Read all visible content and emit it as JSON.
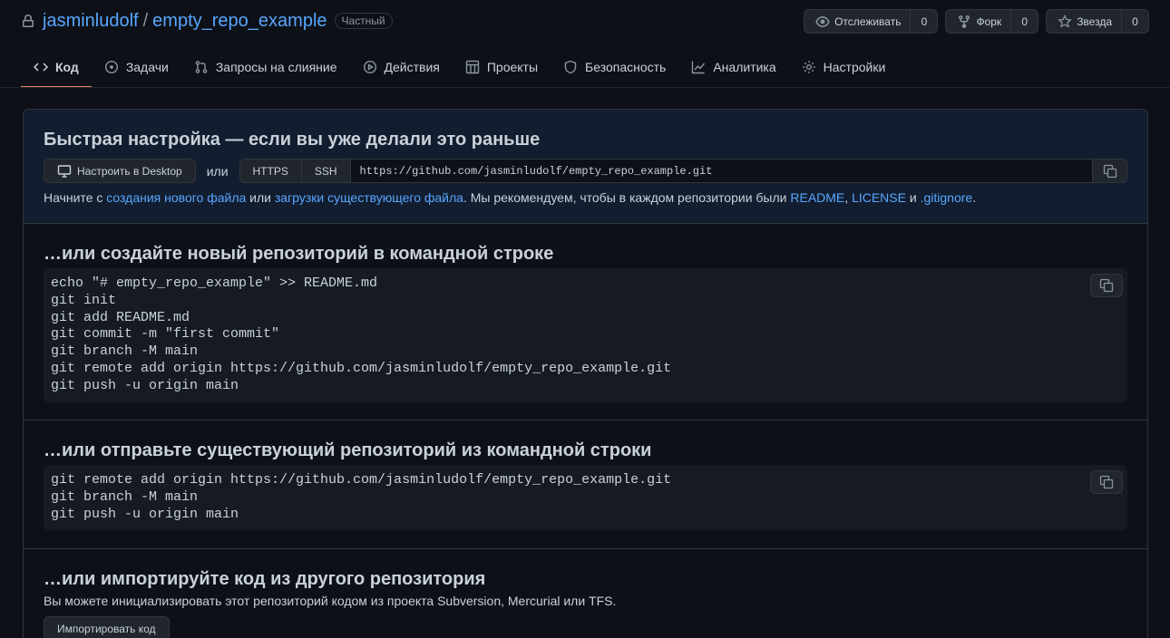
{
  "repo": {
    "owner": "jasminludolf",
    "separator": "/",
    "name": "empty_repo_example",
    "visibility": "Частный"
  },
  "actions": [
    {
      "label": "Отслеживать",
      "count": "0",
      "icon": "eye-icon"
    },
    {
      "label": "Форк",
      "count": "0",
      "icon": "fork-icon"
    },
    {
      "label": "Звезда",
      "count": "0",
      "icon": "star-icon"
    }
  ],
  "tabs": [
    {
      "label": "Код",
      "icon": "code-icon",
      "active": true
    },
    {
      "label": "Задачи",
      "icon": "issue-icon"
    },
    {
      "label": "Запросы на слияние",
      "icon": "pull-request-icon"
    },
    {
      "label": "Действия",
      "icon": "play-icon"
    },
    {
      "label": "Проекты",
      "icon": "table-icon"
    },
    {
      "label": "Безопасность",
      "icon": "shield-icon"
    },
    {
      "label": "Аналитика",
      "icon": "graph-icon"
    },
    {
      "label": "Настройки",
      "icon": "gear-icon"
    }
  ],
  "quick_setup": {
    "title": "Быстрая настройка — если вы уже делали это раньше",
    "desktop_button": "Настроить в Desktop",
    "or": "или",
    "protocols": [
      "HTTPS",
      "SSH"
    ],
    "clone_url": "https://github.com/jasminludolf/empty_repo_example.git",
    "hint_prefix": "Начните с ",
    "hint_link_new_file": "создания нового файла",
    "hint_or": " или ",
    "hint_link_upload": "загрузки существующего файла",
    "hint_middle": ". Мы рекомендуем, чтобы в каждом репозитории были ",
    "hint_readme": "README",
    "hint_comma": ", ",
    "hint_license": "LICENSE",
    "hint_and": " и ",
    "hint_gitignore": ".gitignore",
    "hint_end": "."
  },
  "new_repo": {
    "title": "…или создайте новый репозиторий в командной строке",
    "code": "echo \"# empty_repo_example\" >> README.md\ngit init\ngit add README.md\ngit commit -m \"first commit\"\ngit branch -M main\ngit remote add origin https://github.com/jasminludolf/empty_repo_example.git\ngit push -u origin main"
  },
  "push_existing": {
    "title": "…или отправьте существующий репозиторий из командной строки",
    "code": "git remote add origin https://github.com/jasminludolf/empty_repo_example.git\ngit branch -M main\ngit push -u origin main"
  },
  "import": {
    "title": "…или импортируйте код из другого репозитория",
    "description": "Вы можете инициализировать этот репозиторий кодом из проекта Subversion, Mercurial или TFS.",
    "button": "Импортировать код"
  },
  "colors": {
    "background": "#0d1117",
    "accent_link": "#58a6ff",
    "tab_underline": "#f78166",
    "quick_setup_bg": "#121d2f"
  }
}
